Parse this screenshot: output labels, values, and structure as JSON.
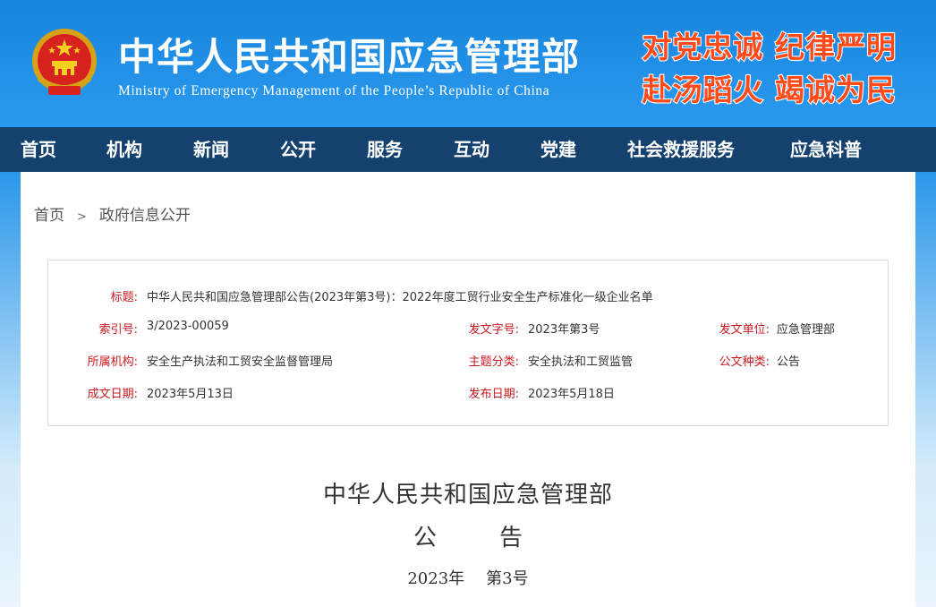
{
  "header": {
    "title": "中华人民共和国应急管理部",
    "subtitle": "Ministry of Emergency Management of the People’s Republic of China",
    "slogan_line1": "对党忠诚 纪律严明",
    "slogan_line2": "赴汤蹈火 竭诚为民",
    "emblem_icon": "national-emblem-icon"
  },
  "nav": {
    "items": [
      "首页",
      "机构",
      "新闻",
      "公开",
      "服务",
      "互动",
      "党建",
      "社会救援服务",
      "应急科普"
    ]
  },
  "breadcrumb": {
    "home": "首页",
    "separator": ">",
    "current": "政府信息公开"
  },
  "info": {
    "title_label": "标题:",
    "title_value": "中华人民共和国应急管理部公告(2023年第3号)：2022年度工贸行业安全生产标准化一级企业名单",
    "index_label": "索引号:",
    "index_value": "3/2023-00059",
    "docno_label": "发文字号:",
    "docno_value": "2023年第3号",
    "issuer_label": "发文单位:",
    "issuer_value": "应急管理部",
    "org_label": "所属机构:",
    "org_value": "安全生产执法和工贸安全监督管理局",
    "topic_label": "主题分类:",
    "topic_value": "安全执法和工贸监管",
    "type_label": "公文种类:",
    "type_value": "公告",
    "created_label": "成文日期:",
    "created_value": "2023年5月13日",
    "published_label": "发布日期:",
    "published_value": "2023年5月18日"
  },
  "document": {
    "heading": "中华人民共和国应急管理部",
    "kind_a": "公",
    "kind_b": "告",
    "year": "2023年",
    "number": "第3号"
  },
  "colors": {
    "header_blue": "#1f8be0",
    "nav_navy": "#14416e",
    "label_red": "#c8191f",
    "slogan_red": "#ff4a1a"
  }
}
